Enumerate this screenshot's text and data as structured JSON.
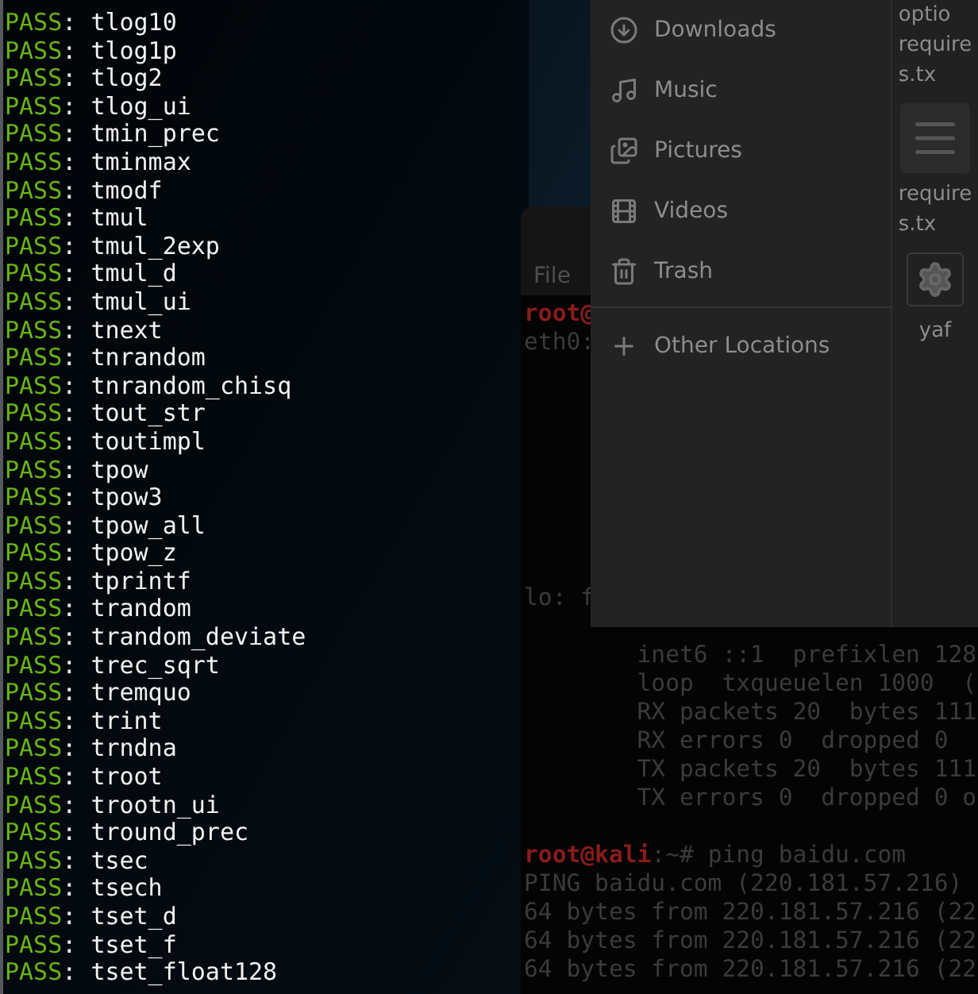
{
  "left_terminal": {
    "lines": [
      {
        "status": "PASS",
        "separator": ":",
        "test": "tlog10"
      },
      {
        "status": "PASS",
        "separator": ":",
        "test": "tlog1p"
      },
      {
        "status": "PASS",
        "separator": ":",
        "test": "tlog2"
      },
      {
        "status": "PASS",
        "separator": ":",
        "test": "tlog_ui"
      },
      {
        "status": "PASS",
        "separator": ":",
        "test": "tmin_prec"
      },
      {
        "status": "PASS",
        "separator": ":",
        "test": "tminmax"
      },
      {
        "status": "PASS",
        "separator": ":",
        "test": "tmodf"
      },
      {
        "status": "PASS",
        "separator": ":",
        "test": "tmul"
      },
      {
        "status": "PASS",
        "separator": ":",
        "test": "tmul_2exp"
      },
      {
        "status": "PASS",
        "separator": ":",
        "test": "tmul_d"
      },
      {
        "status": "PASS",
        "separator": ":",
        "test": "tmul_ui"
      },
      {
        "status": "PASS",
        "separator": ":",
        "test": "tnext"
      },
      {
        "status": "PASS",
        "separator": ":",
        "test": "tnrandom"
      },
      {
        "status": "PASS",
        "separator": ":",
        "test": "tnrandom_chisq"
      },
      {
        "status": "PASS",
        "separator": ":",
        "test": "tout_str"
      },
      {
        "status": "PASS",
        "separator": ":",
        "test": "toutimpl"
      },
      {
        "status": "PASS",
        "separator": ":",
        "test": "tpow"
      },
      {
        "status": "PASS",
        "separator": ":",
        "test": "tpow3"
      },
      {
        "status": "PASS",
        "separator": ":",
        "test": "tpow_all"
      },
      {
        "status": "PASS",
        "separator": ":",
        "test": "tpow_z"
      },
      {
        "status": "PASS",
        "separator": ":",
        "test": "tprintf"
      },
      {
        "status": "PASS",
        "separator": ":",
        "test": "trandom"
      },
      {
        "status": "PASS",
        "separator": ":",
        "test": "trandom_deviate"
      },
      {
        "status": "PASS",
        "separator": ":",
        "test": "trec_sqrt"
      },
      {
        "status": "PASS",
        "separator": ":",
        "test": "tremquo"
      },
      {
        "status": "PASS",
        "separator": ":",
        "test": "trint"
      },
      {
        "status": "PASS",
        "separator": ":",
        "test": "trndna"
      },
      {
        "status": "PASS",
        "separator": ":",
        "test": "troot"
      },
      {
        "status": "PASS",
        "separator": ":",
        "test": "trootn_ui"
      },
      {
        "status": "PASS",
        "separator": ":",
        "test": "tround_prec"
      },
      {
        "status": "PASS",
        "separator": ":",
        "test": "tsec"
      },
      {
        "status": "PASS",
        "separator": ":",
        "test": "tsech"
      },
      {
        "status": "PASS",
        "separator": ":",
        "test": "tset_d"
      },
      {
        "status": "PASS",
        "separator": ":",
        "test": "tset_f"
      },
      {
        "status": "PASS",
        "separator": ":",
        "test": "tset_float128"
      }
    ]
  },
  "right_terminal": {
    "menu": [
      "File"
    ],
    "top_lines": [
      {
        "kind": "prompt",
        "user": "root@"
      },
      {
        "kind": "output",
        "text": "eth0:"
      }
    ],
    "bottom_lines": [
      {
        "kind": "output",
        "text": "lo: f"
      },
      {
        "kind": "output",
        "text": "        inet6 ::1  prefixlen 128"
      },
      {
        "kind": "output",
        "text": "        loop  txqueuelen 1000  ("
      },
      {
        "kind": "output",
        "text": "        RX packets 20  bytes 111"
      },
      {
        "kind": "output",
        "text": "        RX errors 0  dropped 0"
      },
      {
        "kind": "output",
        "text": "        TX packets 20  bytes 111"
      },
      {
        "kind": "output",
        "text": "        TX errors 0  dropped 0 o"
      },
      {
        "kind": "blank"
      },
      {
        "kind": "prompt",
        "user": "root@kali",
        "rest": ":~# ping baidu.com"
      },
      {
        "kind": "output",
        "text": "PING baidu.com (220.181.57.216)"
      },
      {
        "kind": "output",
        "text": "64 bytes from 220.181.57.216 (22"
      },
      {
        "kind": "output",
        "text": "64 bytes from 220.181.57.216 (22"
      },
      {
        "kind": "output",
        "text": "64 bytes from 220.181.57.216 (22"
      }
    ]
  },
  "file_manager": {
    "places": [
      {
        "kind": "download",
        "label": "Downloads"
      },
      {
        "kind": "music",
        "label": "Music"
      },
      {
        "kind": "pictures",
        "label": "Pictures"
      },
      {
        "kind": "videos",
        "label": "Videos"
      },
      {
        "kind": "trash",
        "label": "Trash"
      }
    ],
    "other_locations": {
      "label": "Other Locations"
    },
    "files": [
      {
        "kind": "none",
        "lines": [
          "optio",
          "require",
          "s.tx"
        ]
      },
      {
        "kind": "document",
        "lines": [
          "require",
          "s.tx"
        ]
      },
      {
        "kind": "settings",
        "lines": [
          "yaf"
        ]
      }
    ]
  }
}
